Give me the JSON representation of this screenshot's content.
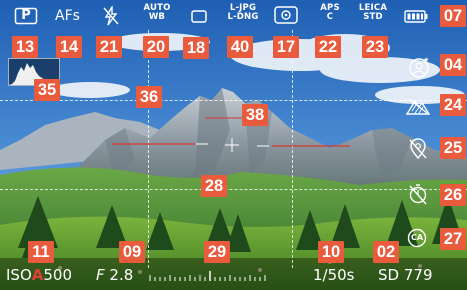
{
  "top_bar": {
    "mode": "P",
    "focus": "AFs",
    "white_balance": [
      "AUTO",
      "WB"
    ],
    "file_format": [
      "L-JPG",
      "L-DNG"
    ],
    "sensor": [
      "APS",
      "C"
    ],
    "film_style": [
      "LEICA",
      "STD"
    ]
  },
  "bottom_bar": {
    "iso_label": "ISO",
    "iso_auto": "A",
    "iso_value": "500",
    "aperture_label": "F",
    "aperture_value": "2.8",
    "shutter": "1/50s",
    "storage_label": "SD",
    "shots_remaining": "779"
  },
  "right_column": {
    "ca_label": "CA"
  },
  "callouts": {
    "c07": "07",
    "c04": "04",
    "c24": "24",
    "c25": "25",
    "c26": "26",
    "c27": "27",
    "c13": "13",
    "c14": "14",
    "c21": "21",
    "c20": "20",
    "c18": "18",
    "c40": "40",
    "c17": "17",
    "c22": "22",
    "c23": "23",
    "c35": "35",
    "c36": "36",
    "c38": "38",
    "c28": "28",
    "c11": "11",
    "c09": "09",
    "c29": "29",
    "c10": "10",
    "c02": "02"
  },
  "colors": {
    "callout": "#ea5a3c",
    "level_line": "#d63a2e",
    "iso_auto": "#e0403a"
  },
  "icons": {
    "mode": "p-mode-icon",
    "flash": "flash-off-icon",
    "drive": "single-shot-icon",
    "metering": "spot-metering-icon",
    "battery": "battery-icon",
    "settings": "user-profile-icon",
    "hills": "mountain-hatched-icon",
    "no_location": "location-off-icon",
    "timer": "self-timer-off-icon",
    "ca": "color-auto-icon"
  }
}
